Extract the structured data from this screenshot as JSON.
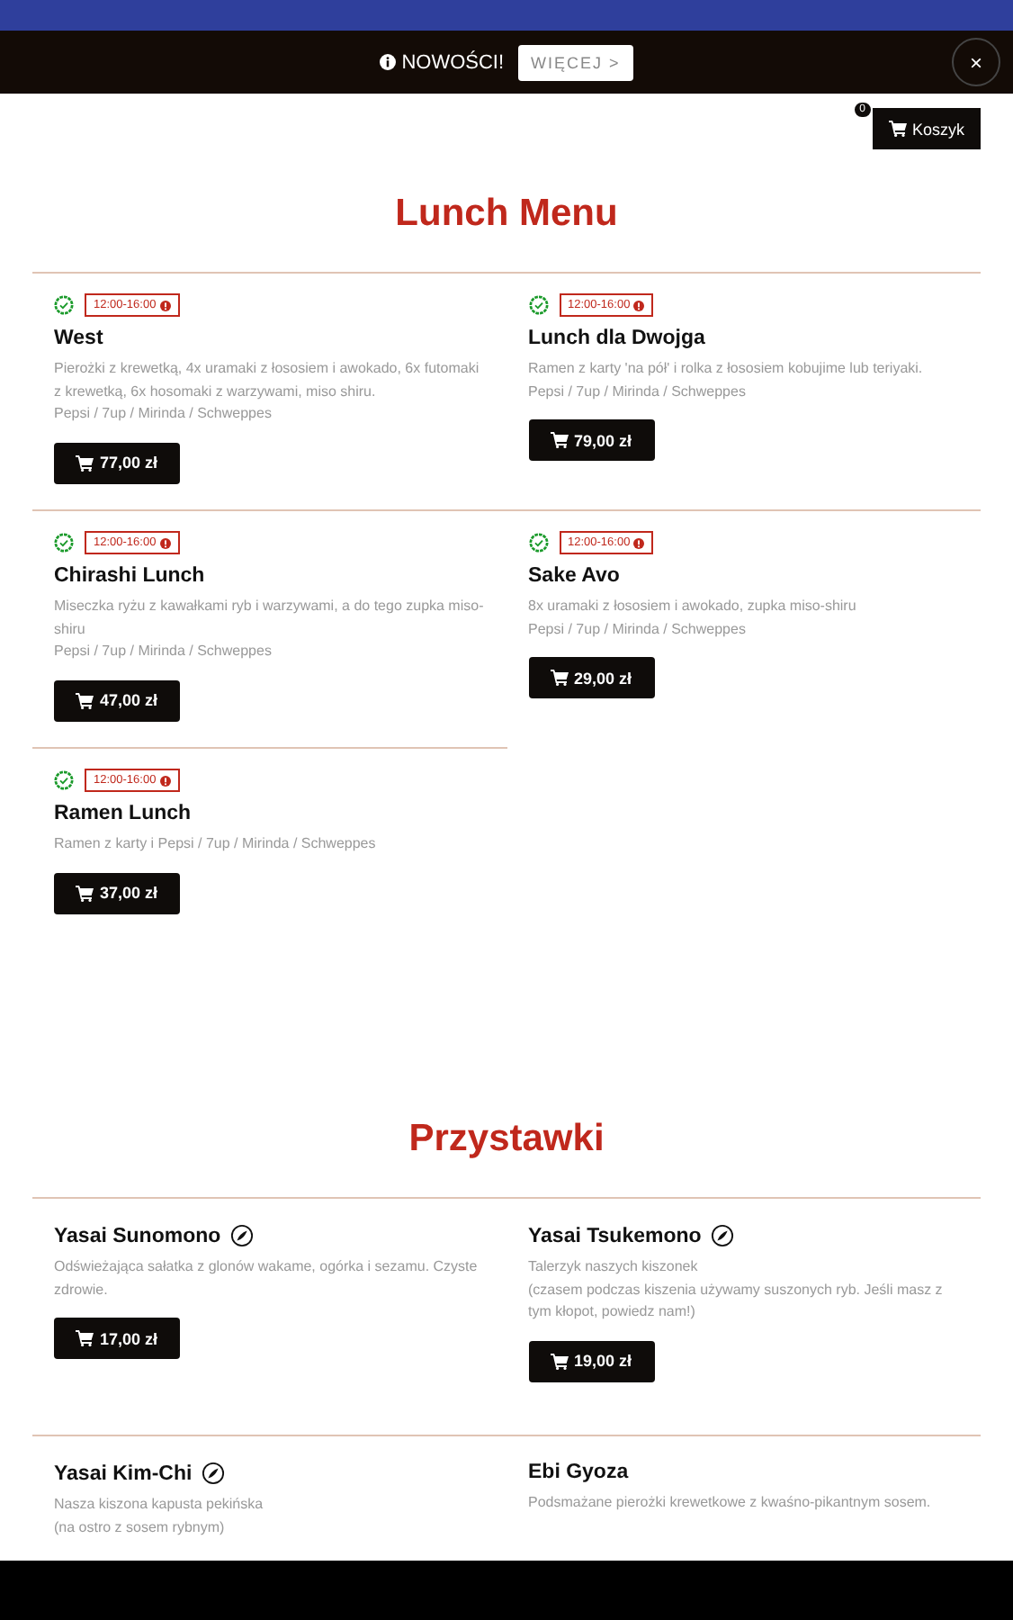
{
  "notice": {
    "label": "NOWOŚCI!",
    "button": "WIĘCEJ >",
    "close": "×"
  },
  "cart": {
    "label": "Koszyk",
    "count": "0"
  },
  "sections": [
    {
      "title": "Lunch Menu",
      "items": [
        {
          "name": "West",
          "time": "12:00-16:00",
          "available": true,
          "description": [
            "Pierożki z krewetką, 4x uramaki z łososiem i awokado, 6x futomaki z krewetką, 6x hosomaki z warzywami, miso shiru.",
            "Pepsi / 7up / Mirinda / Schweppes"
          ],
          "price": "77,00 zł"
        },
        {
          "name": "Lunch dla Dwojga",
          "time": "12:00-16:00",
          "available": true,
          "description": [
            "Ramen z karty 'na pół' i rolka z łososiem kobujime lub teriyaki.",
            "Pepsi / 7up / Mirinda / Schweppes"
          ],
          "price": "79,00 zł"
        },
        {
          "name": "Chirashi Lunch",
          "time": "12:00-16:00",
          "available": true,
          "description": [
            "Miseczka ryżu z kawałkami ryb i warzywami, a do tego zupka miso-shiru",
            "Pepsi / 7up / Mirinda / Schweppes"
          ],
          "price": "47,00 zł"
        },
        {
          "name": "Sake Avo",
          "time": "12:00-16:00",
          "available": true,
          "description": [
            "8x uramaki z łososiem i awokado, zupka miso-shiru",
            "Pepsi / 7up / Mirinda / Schweppes"
          ],
          "price": "29,00 zł"
        },
        {
          "name": "Ramen Lunch",
          "time": "12:00-16:00",
          "available": true,
          "description": [
            "Ramen z karty i Pepsi / 7up / Mirinda / Schweppes"
          ],
          "price": "37,00 zł"
        }
      ]
    },
    {
      "title": "Przystawki",
      "items": [
        {
          "name": "Yasai Sunomono",
          "vegetarian": true,
          "description": [
            "Odświeżająca sałatka z glonów wakame, ogórka i sezamu. Czyste zdrowie."
          ],
          "price": "17,00 zł"
        },
        {
          "name": "Yasai Tsukemono",
          "vegetarian": true,
          "description": [
            "Talerzyk naszych kiszonek",
            "(czasem podczas kiszenia używamy suszonych ryb. Jeśli masz z tym kłopot, powiedz nam!)"
          ],
          "price": "19,00 zł"
        },
        {
          "name": "Yasai Kim-Chi",
          "vegetarian": true,
          "description": [
            "Nasza kiszona kapusta pekińska",
            "(na ostro z sosem rybnym)"
          ]
        },
        {
          "name": "Ebi Gyoza",
          "vegetarian": false,
          "description": [
            "Podsmażane pierożki krewetkowe z kwaśno-pikantnym sosem."
          ]
        }
      ]
    }
  ]
}
